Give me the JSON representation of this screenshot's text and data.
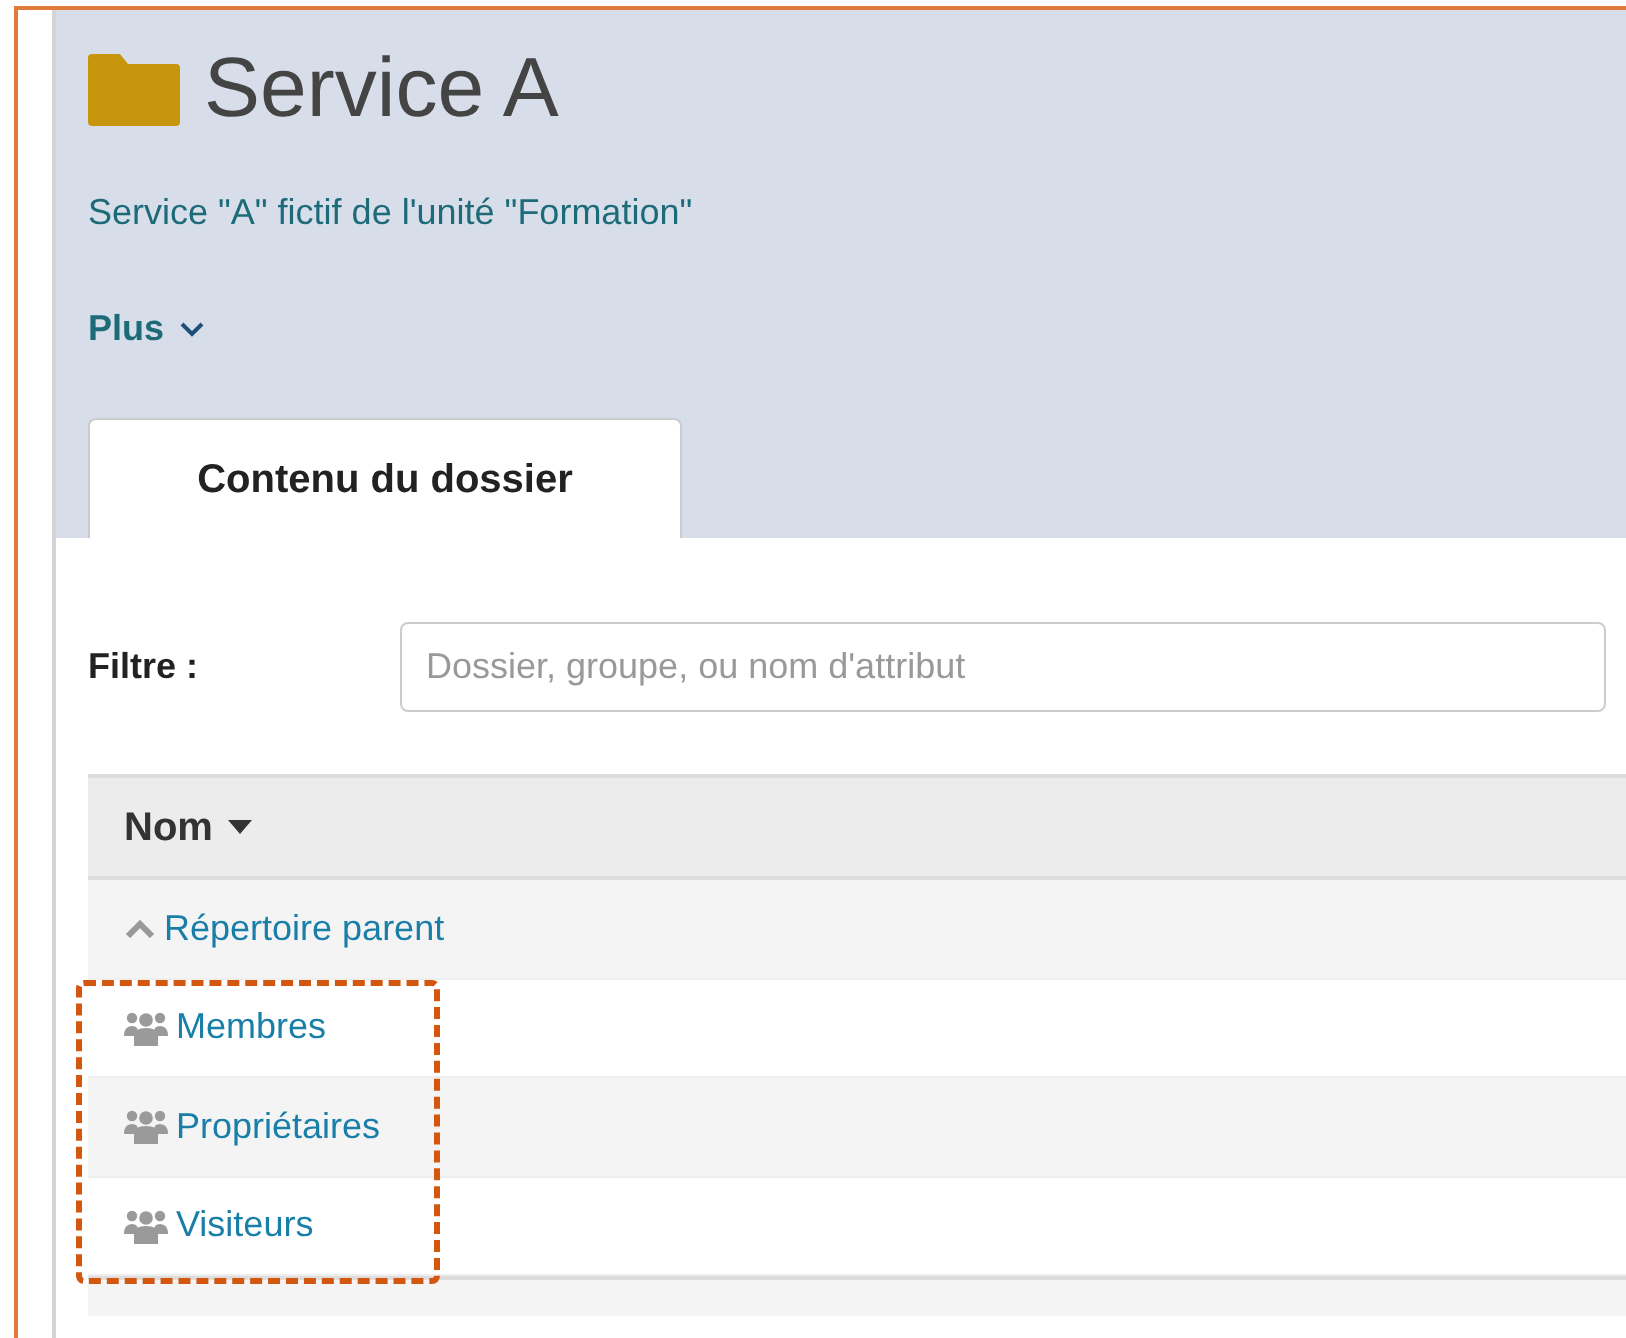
{
  "header": {
    "title": "Service A",
    "description": "Service \"A\" fictif de l'unité \"Formation\"",
    "more": "Plus"
  },
  "tabs": [
    {
      "label": "Contenu du dossier",
      "selected": true
    }
  ],
  "filter": {
    "label": "Filtre :",
    "placeholder": "Dossier, groupe, ou nom d'attribut"
  },
  "table": {
    "columns": [
      {
        "label": "Nom",
        "sorted": true
      }
    ],
    "rows": [
      {
        "kind": "parent",
        "label": "Répertoire parent",
        "highlighted": false
      },
      {
        "kind": "group",
        "label": "Membres",
        "highlighted": true
      },
      {
        "kind": "group",
        "label": "Propriétaires",
        "highlighted": true
      },
      {
        "kind": "group",
        "label": "Visiteurs",
        "highlighted": true
      }
    ]
  }
}
